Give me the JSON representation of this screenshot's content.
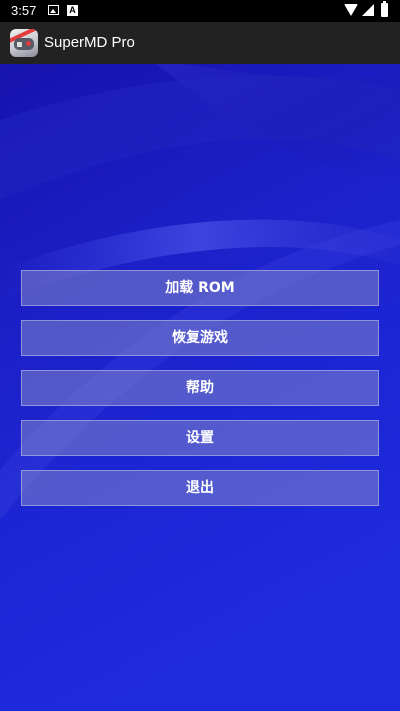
{
  "status_bar": {
    "time": "3:57",
    "notification_a": "A",
    "icons": [
      "image-notification-icon",
      "a-notification-icon",
      "wifi-icon",
      "signal-icon",
      "battery-icon"
    ]
  },
  "app_bar": {
    "title": "SuperMD Pro",
    "icon": "gamepad-app-icon"
  },
  "menu": {
    "load_rom": "加载 ROM",
    "restore_game": "恢复游戏",
    "help": "帮助",
    "settings": "设置",
    "exit": "退出"
  },
  "colors": {
    "background": "#1a1dc4",
    "app_bar": "#222222",
    "status_bar": "#000000",
    "button_fill": "#8287c8"
  }
}
